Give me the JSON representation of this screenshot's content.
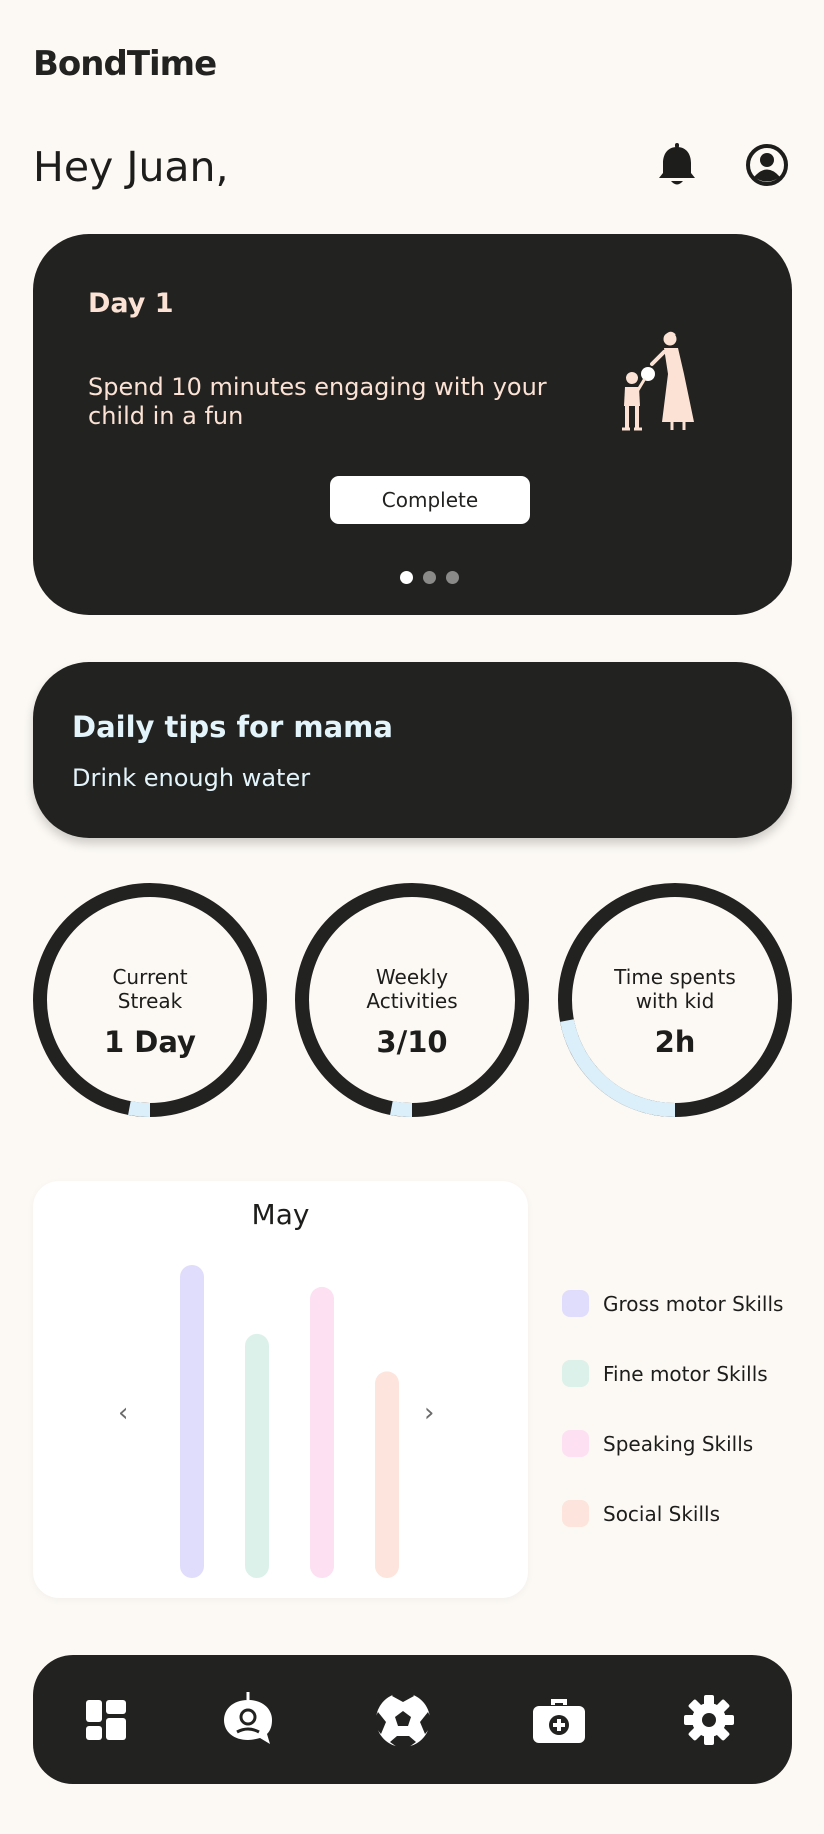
{
  "app": {
    "brand": "BondTime"
  },
  "header": {
    "greeting": "Hey Juan,"
  },
  "day_card": {
    "title": "Day 1",
    "text": "Spend 10 minutes engaging with your child in a fun",
    "button_label": "Complete",
    "pager": {
      "pages": 3,
      "active": 1
    }
  },
  "tips": {
    "title": "Daily tips for mama",
    "text": "Drink enough water"
  },
  "stats": [
    {
      "label_line1": "Current",
      "label_line2": "Streak",
      "value": "1 Day",
      "progress": 0.03
    },
    {
      "label_line1": "Weekly",
      "label_line2": "Activities",
      "value": "3/10",
      "progress": 0.03
    },
    {
      "label_line1": "Time spents",
      "label_line2": "with kid",
      "value": "2h",
      "progress": 0.22
    }
  ],
  "chart_data": {
    "type": "bar",
    "title": "May",
    "categories": [
      "Gross motor Skills",
      "Fine motor Skills",
      "Speaking Skills",
      "Social Skills"
    ],
    "values": [
      100,
      78,
      93,
      66
    ],
    "ylim": [
      0,
      100
    ],
    "grid": false,
    "legend": "right",
    "colors": [
      "#e0dcfc",
      "#dcf1ea",
      "#fde0f2",
      "#fde4dc"
    ]
  },
  "colors": {
    "background": "#fcf9f4",
    "card": "#222220",
    "accent_warm": "#fbe2d4",
    "accent_cool": "#e4f4fb",
    "ring_progress": "#dbeffb"
  },
  "nav": {
    "items": [
      "dashboard-icon",
      "chat-bot-icon",
      "soccer-ball-icon",
      "first-aid-kit-icon",
      "settings-gear-icon"
    ]
  }
}
